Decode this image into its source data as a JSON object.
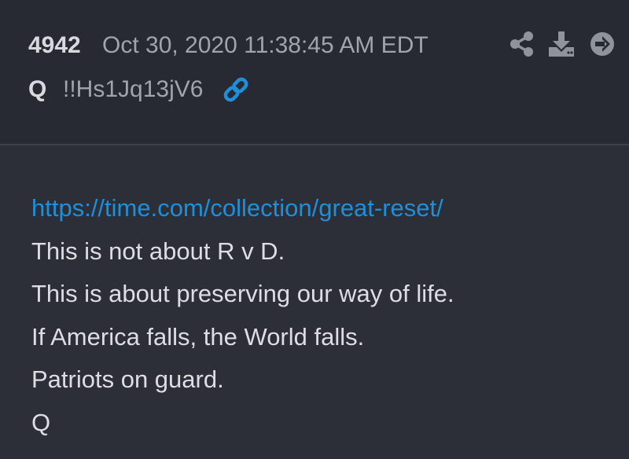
{
  "post": {
    "number": "4942",
    "timestamp": "Oct 30, 2020 11:38:45 AM EDT",
    "author": "Q",
    "tripcode": "!!Hs1Jq13jV6"
  },
  "actions": {
    "link_icon": "link-icon",
    "share_icon": "share-icon",
    "download_icon": "download-icon",
    "goto_icon": "arrow-circle-right-icon"
  },
  "message": {
    "link": "https://time.com/collection/great-reset/",
    "lines": [
      "This is not about R v D.",
      "This is about preserving our way of life.",
      "If America falls, the World falls.",
      "Patriots on guard.",
      "Q"
    ]
  },
  "colors": {
    "header_bg": "#272a33",
    "body_bg": "#2c2f38",
    "link": "#1e8fd8",
    "text": "#dcdee3",
    "muted": "#a0a4ad",
    "icon": "#8e939c"
  }
}
